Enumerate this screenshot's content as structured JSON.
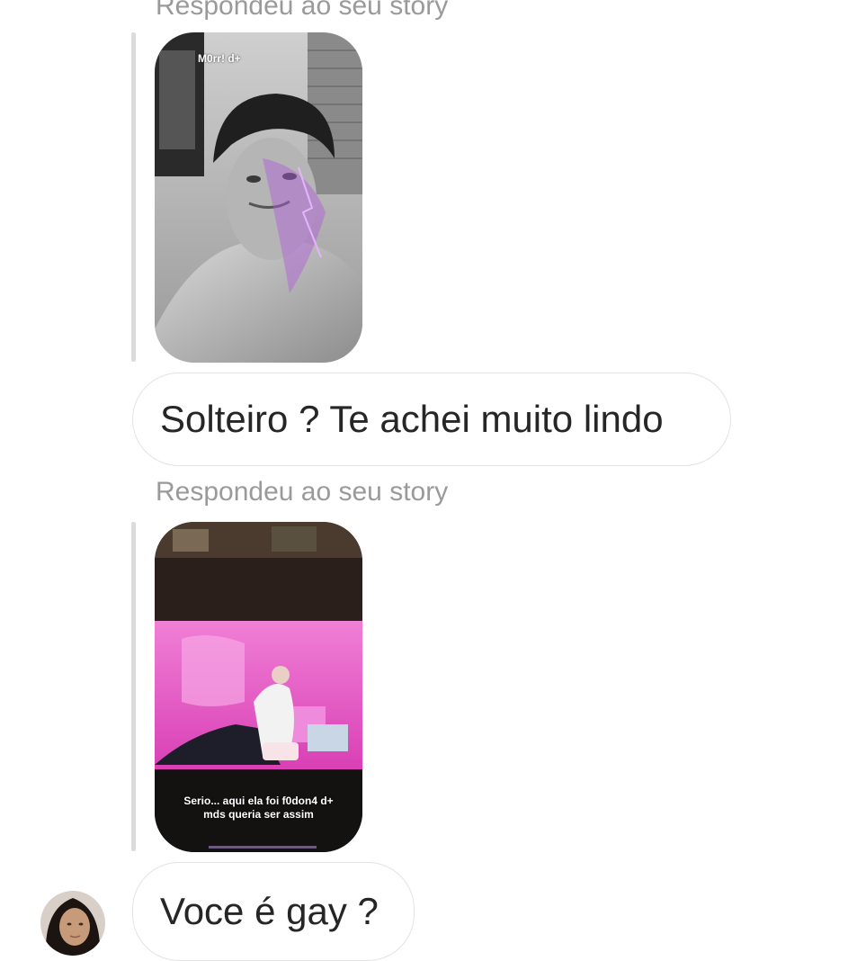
{
  "thread": {
    "messages": [
      {
        "reply_label": "Respondeu ao seu story",
        "story_caption": "M0rr! d+",
        "text": "Solteiro ? Te achei muito lindo"
      },
      {
        "reply_label": "Respondeu ao seu story",
        "story_caption_line1": "Serio... aqui ela foi f0don4 d+",
        "story_caption_line2": "mds queria ser assim",
        "text": "Voce é gay ?"
      }
    ]
  },
  "colors": {
    "bubble_border": "#e3e3e3",
    "label_grey": "#9a9a9a",
    "text": "#262626",
    "quote_bar": "#dbdbdb",
    "story2_pink": "#e84fc0"
  }
}
